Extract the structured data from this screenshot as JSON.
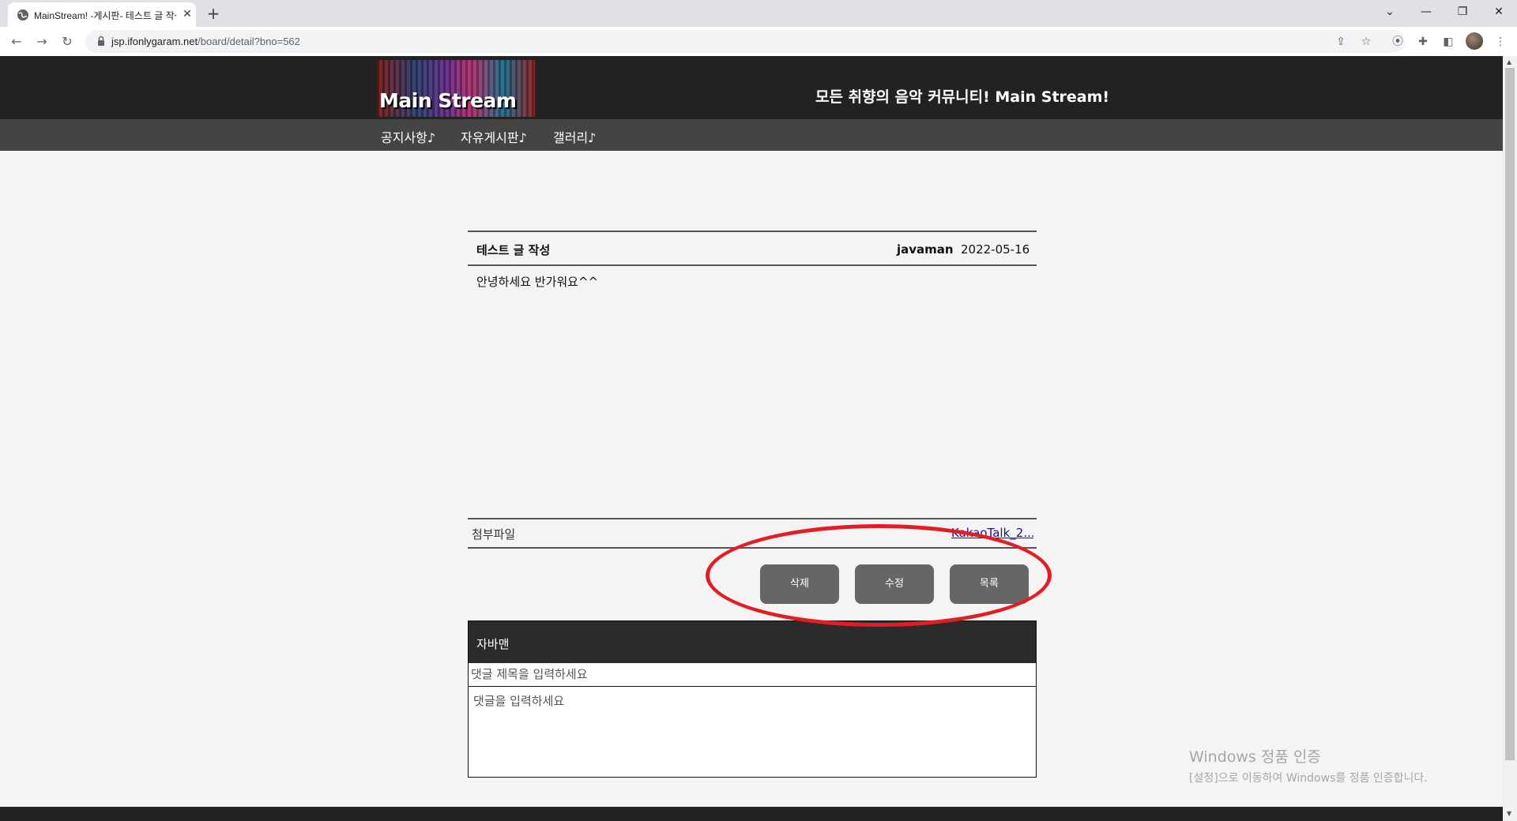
{
  "browser": {
    "tab_title": "MainStream! -게시판- 테스트 글 작성",
    "url_host": "jsp.ifonlygaram.net",
    "url_path": "/board/detail?bno=562"
  },
  "site": {
    "logo_text": "Main Stream",
    "tagline": "모든 취향의 음악 커뮤니티! Main Stream!",
    "nav": [
      "공지사항♪",
      "자유게시판♪",
      "갤러리♪"
    ]
  },
  "post": {
    "title": "테스트 글 작성",
    "author": "javaman",
    "date": "2022-05-16",
    "body": "안녕하세요 반가워요^^",
    "attachment_label": "첨부파일",
    "attachment_name": "KakaoTalk_2..."
  },
  "buttons": {
    "delete": "삭제",
    "edit": "수정",
    "list": "목록"
  },
  "comment": {
    "username": "자바맨",
    "title_placeholder": "댓글 제목을 입력하세요",
    "body_placeholder": "댓글을 입력하세요"
  },
  "watermark": {
    "line1": "Windows 정품 인증",
    "line2": "[설정]으로 이동하여 Windows를 정품 인증합니다."
  },
  "colors": {
    "header_bg": "#222222",
    "nav_bg": "#444444",
    "button_bg": "#666666",
    "annotation": "#e31d25"
  }
}
